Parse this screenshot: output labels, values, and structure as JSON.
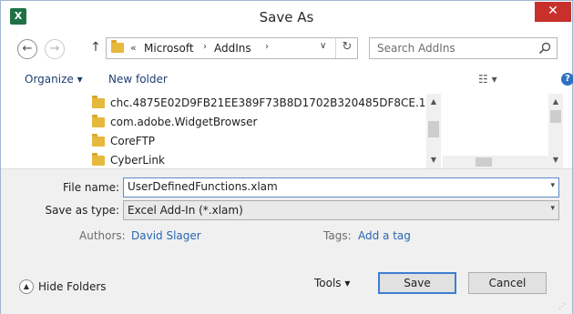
{
  "window": {
    "title": "Save As",
    "app_icon_text": "X",
    "close_glyph": "✕"
  },
  "nav": {
    "back_glyph": "←",
    "forward_glyph": "→",
    "up_glyph": "↑",
    "breadcrumb_overflow": "«",
    "breadcrumb": [
      "Microsoft",
      "AddIns"
    ],
    "separator": "›",
    "dropdown_glyph": "∨",
    "refresh_glyph": "↻"
  },
  "search": {
    "placeholder": "Search AddIns"
  },
  "toolbar": {
    "organize_label": "Organize ▾",
    "new_folder_label": "New folder",
    "view_label": "☷  ▾",
    "help_glyph": "?"
  },
  "files": [
    {
      "name": "chc.4875E02D9FB21EE389F73B8D1702B320485DF8CE.1"
    },
    {
      "name": "com.adobe.WidgetBrowser"
    },
    {
      "name": "CoreFTP"
    },
    {
      "name": "CyberLink"
    }
  ],
  "scroll": {
    "up_glyph": "▲",
    "down_glyph": "▼"
  },
  "form": {
    "file_name_label": "File name:",
    "file_name_value": "UserDefinedFunctions.xlam",
    "save_as_type_label": "Save as type:",
    "save_as_type_value": "Excel Add-In (*.xlam)",
    "dropdown_glyph": "▾",
    "authors_label": "Authors:",
    "authors_value": "David Slager",
    "tags_label": "Tags:",
    "tags_value": "Add a tag"
  },
  "footer": {
    "hide_folders_label": "Hide Folders",
    "hide_folders_glyph": "▲",
    "tools_label": "Tools   ▾",
    "save_label": "Save",
    "cancel_label": "Cancel",
    "grip_glyph": "⋰"
  },
  "colors": {
    "accent": "#3c7fd1",
    "link": "#2a66b2",
    "close": "#c7302b",
    "excel_green": "#1f7145",
    "folder": "#e6b83c"
  }
}
